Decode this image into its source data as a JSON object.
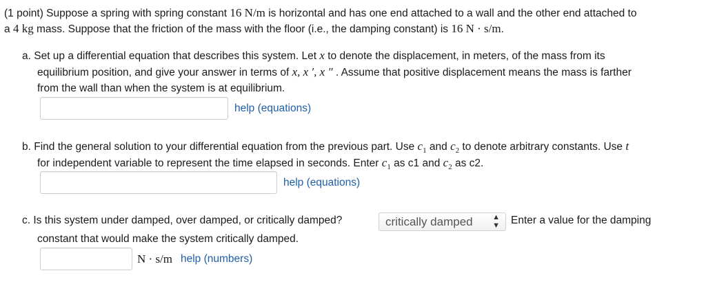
{
  "intro": {
    "l1_a": "(1 point) Suppose a spring with spring constant ",
    "l1_k": "16 N/m",
    "l1_b": " is horizontal and has one end attached to a wall and the other end attached to",
    "l2_a": "a ",
    "l2_m": "4 kg",
    "l2_b": " mass. Suppose that the friction of the mass with the floor (i.e., the damping constant) is ",
    "l2_c": "16 N · s/m",
    "l2_d": "."
  },
  "part_a": {
    "l1": "a.  Set up a differential equation that describes this system. Let ",
    "l1_x": "x",
    "l1_b": " to denote the displacement, in meters, of the mass from its",
    "l2_a": "equilibrium position, and give your answer in terms of ",
    "l2_vars": "x, x ′, x ″",
    "l2_b": " . Assume that positive displacement means the mass is farther",
    "l3": "from the wall than when the system is at equilibrium.",
    "help": "help (equations)"
  },
  "part_b": {
    "l1_a": "b.  Find the general solution to your differential equation from the previous part. Use ",
    "c": "c",
    "one": "1",
    "and": "  and ",
    "two": "2",
    "l1_b": "  to denote arbitrary constants. Use ",
    "t": "t",
    "l2_a": "for independent variable to represent the time elapsed in seconds. Enter ",
    "as1": "  as c1 and ",
    "as2": "  as c2.",
    "help": "help (equations)"
  },
  "part_c": {
    "l1": "c.  Is this system under damped, over damped, or critically damped?",
    "select_value": "critically damped",
    "after": "Enter a value for the damping",
    "l2": "constant that would make the system critically damped.",
    "unit": "N · s/m",
    "help": "help (numbers)"
  }
}
